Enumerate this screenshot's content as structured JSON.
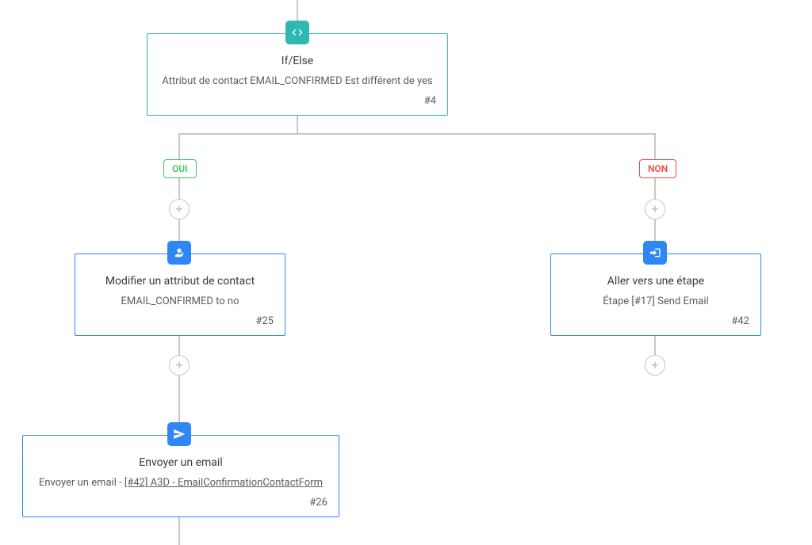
{
  "node4": {
    "title": "If/Else",
    "subtitle": "Attribut de contact EMAIL_CONFIRMED Est différent de yes",
    "id": "#4"
  },
  "branches": {
    "oui": "OUI",
    "non": "NON"
  },
  "node25": {
    "title": "Modifier un attribut de contact",
    "subtitle": "EMAIL_CONFIRMED to no",
    "id": "#25"
  },
  "node42": {
    "title": "Aller vers une étape",
    "subtitle": "Étape [#17] Send Email",
    "id": "#42"
  },
  "node26": {
    "title": "Envoyer un email",
    "subtitle_prefix": "Envoyer un email - ",
    "subtitle_link": "[#42] A3D - EmailConfirmationContactForm",
    "id": "#26"
  }
}
